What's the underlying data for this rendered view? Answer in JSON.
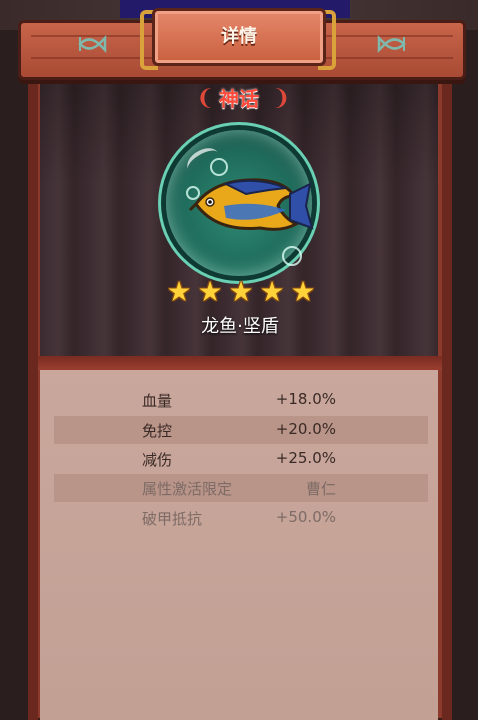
{
  "header": {
    "title": "详情"
  },
  "card": {
    "rarity": "神话",
    "name": "龙鱼·坚盾",
    "stars": 5
  },
  "stats": [
    {
      "label": "血量",
      "value": "+18.0%",
      "dim": false
    },
    {
      "label": "免控",
      "value": "+20.0%",
      "dim": false
    },
    {
      "label": "减伤",
      "value": "+25.0%",
      "dim": false
    },
    {
      "label": "属性激活限定",
      "value": "曹仁",
      "dim": true
    },
    {
      "label": "破甲抵抗",
      "value": "+50.0%",
      "dim": true
    }
  ],
  "colors": {
    "rarity": "#ff4a3a",
    "star": "#ffd23a",
    "frame": "#8b3a2c"
  },
  "icons": {
    "header_left": "fish-badge-icon",
    "header_right": "fish-badge-icon",
    "star": "star-icon"
  }
}
